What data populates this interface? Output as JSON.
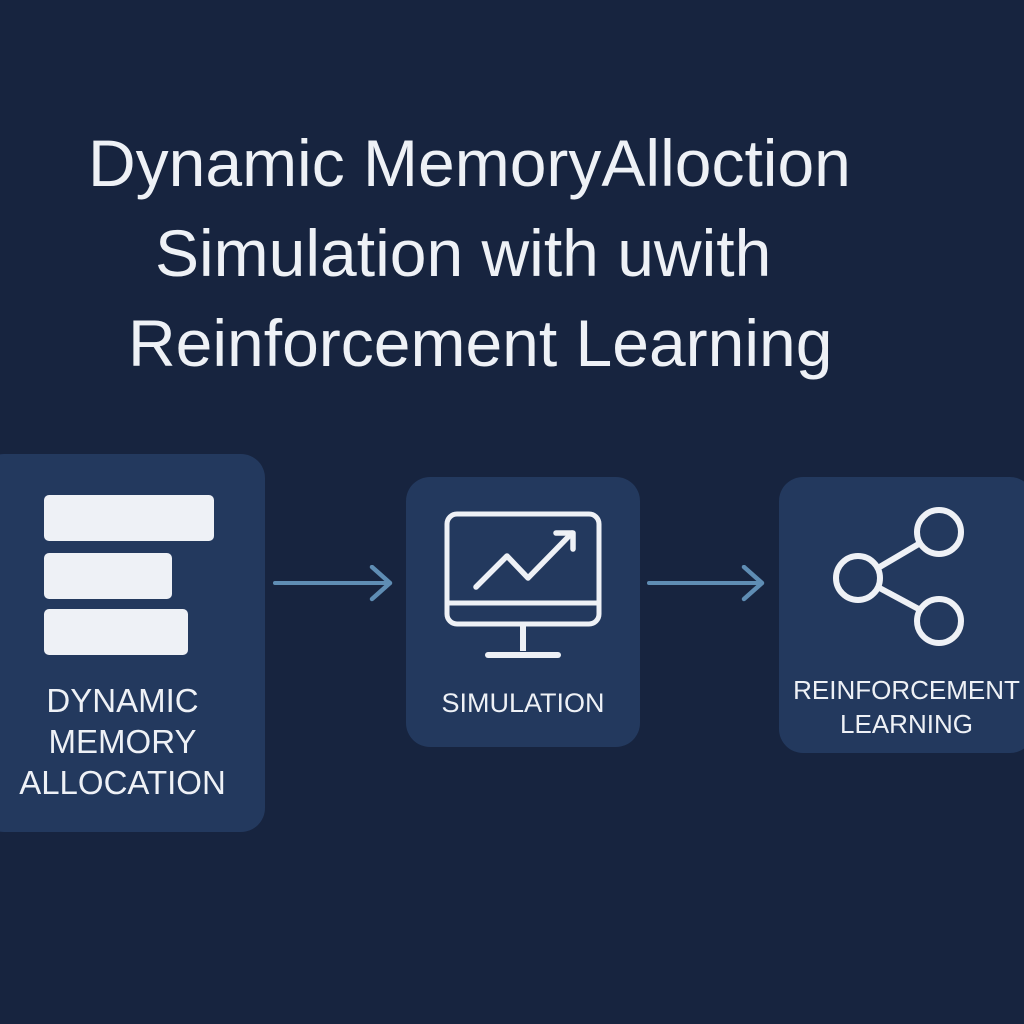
{
  "title": {
    "line1": "Dynamic MemoryAlloction",
    "line2": "Simulation with uwith",
    "line3": "Reinforcement Learning"
  },
  "steps": [
    {
      "label_lines": [
        "DYNAMIC",
        "MEMORY",
        "ALLOCATION"
      ],
      "icon": "memory-blocks-icon"
    },
    {
      "label_lines": [
        "SIMULATION"
      ],
      "icon": "monitor-chart-icon"
    },
    {
      "label_lines": [
        "REINFORCEMENT",
        "LEARNING"
      ],
      "icon": "share-nodes-icon"
    }
  ],
  "colors": {
    "background": "#17243f",
    "card": "#23395e",
    "text": "#eef1f6",
    "arrow": "#5f8db4"
  }
}
